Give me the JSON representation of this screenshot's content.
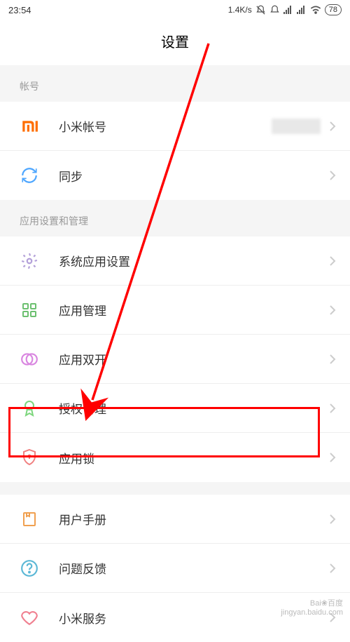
{
  "status": {
    "time": "23:54",
    "speed": "1.4K/s",
    "battery": "78"
  },
  "title": "设置",
  "sections": [
    {
      "header": "帐号",
      "items": [
        {
          "label": "小米帐号",
          "hasValue": true
        },
        {
          "label": "同步"
        }
      ]
    },
    {
      "header": "应用设置和管理",
      "items": [
        {
          "label": "系统应用设置"
        },
        {
          "label": "应用管理"
        },
        {
          "label": "应用双开"
        },
        {
          "label": "授权管理"
        },
        {
          "label": "应用锁"
        }
      ]
    },
    {
      "header": "",
      "items": [
        {
          "label": "用户手册"
        },
        {
          "label": "问题反馈"
        },
        {
          "label": "小米服务"
        }
      ]
    }
  ],
  "watermark": {
    "line1": "Bai❀百度",
    "line2": "jingyan.baidu.com"
  }
}
